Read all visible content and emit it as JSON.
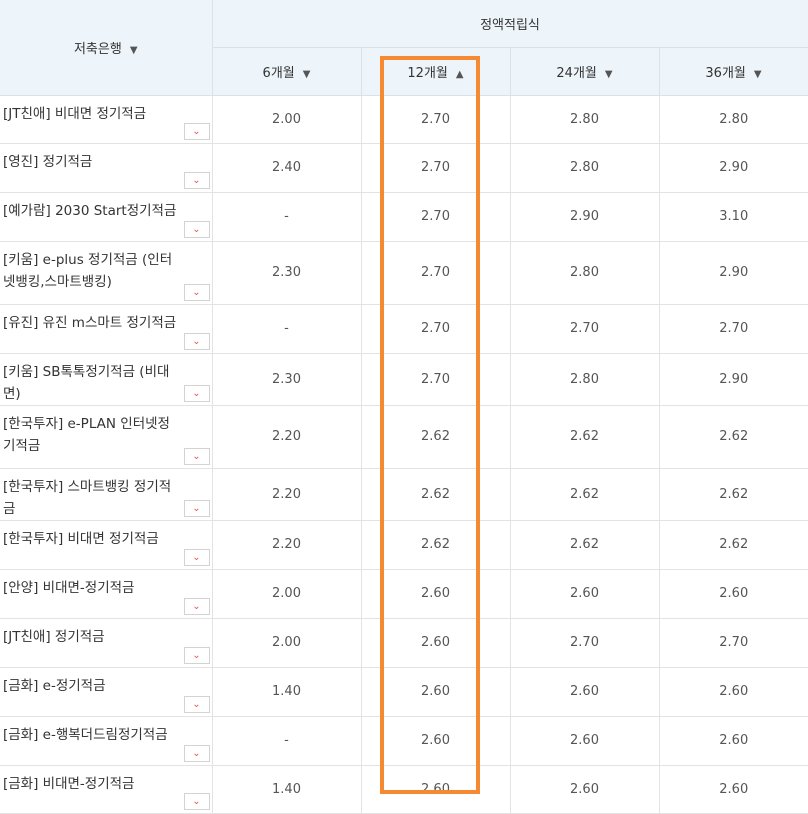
{
  "header": {
    "bank": "저축은행",
    "group": "정액적립식",
    "terms": [
      "6개월",
      "12개월",
      "24개월",
      "36개월"
    ],
    "sort": {
      "bank": "▼",
      "terms": [
        "▼",
        "▲",
        "▼",
        "▼"
      ]
    }
  },
  "rows": [
    {
      "name": "[JT친애] 비대면 정기적금",
      "rates": [
        "2.00",
        "2.70",
        "2.80",
        "2.80"
      ]
    },
    {
      "name": "[영진] 정기적금",
      "rates": [
        "2.40",
        "2.70",
        "2.80",
        "2.90"
      ]
    },
    {
      "name": "[예가람] 2030 Start정기적금",
      "rates": [
        "-",
        "2.70",
        "2.90",
        "3.10"
      ]
    },
    {
      "name": "[키움] e-plus 정기적금 (인터넷뱅킹,스마트뱅킹)",
      "rates": [
        "2.30",
        "2.70",
        "2.80",
        "2.90"
      ]
    },
    {
      "name": "[유진] 유진 m스마트 정기적금",
      "rates": [
        "-",
        "2.70",
        "2.70",
        "2.70"
      ]
    },
    {
      "name": "[키움] SB톡톡정기적금 (비대면)",
      "rates": [
        "2.30",
        "2.70",
        "2.80",
        "2.90"
      ]
    },
    {
      "name": "[한국투자] e-PLAN 인터넷정기적금",
      "rates": [
        "2.20",
        "2.62",
        "2.62",
        "2.62"
      ]
    },
    {
      "name": "[한국투자] 스마트뱅킹 정기적금",
      "rates": [
        "2.20",
        "2.62",
        "2.62",
        "2.62"
      ]
    },
    {
      "name": "[한국투자] 비대면 정기적금",
      "rates": [
        "2.20",
        "2.62",
        "2.62",
        "2.62"
      ]
    },
    {
      "name": "[안양] 비대면-정기적금",
      "rates": [
        "2.00",
        "2.60",
        "2.60",
        "2.60"
      ]
    },
    {
      "name": "[JT친애] 정기적금",
      "rates": [
        "2.00",
        "2.60",
        "2.70",
        "2.70"
      ]
    },
    {
      "name": "[금화] e-정기적금",
      "rates": [
        "1.40",
        "2.60",
        "2.60",
        "2.60"
      ]
    },
    {
      "name": "[금화] e-행복더드림정기적금",
      "rates": [
        "-",
        "2.60",
        "2.60",
        "2.60"
      ]
    },
    {
      "name": "[금화] 비대면-정기적금",
      "rates": [
        "1.40",
        "2.60",
        "2.60",
        "2.60"
      ]
    }
  ],
  "colors": {
    "highlight": "#f58a33",
    "header_bg": "#eef5fa",
    "dropdown_arrow": "#e0595b"
  }
}
